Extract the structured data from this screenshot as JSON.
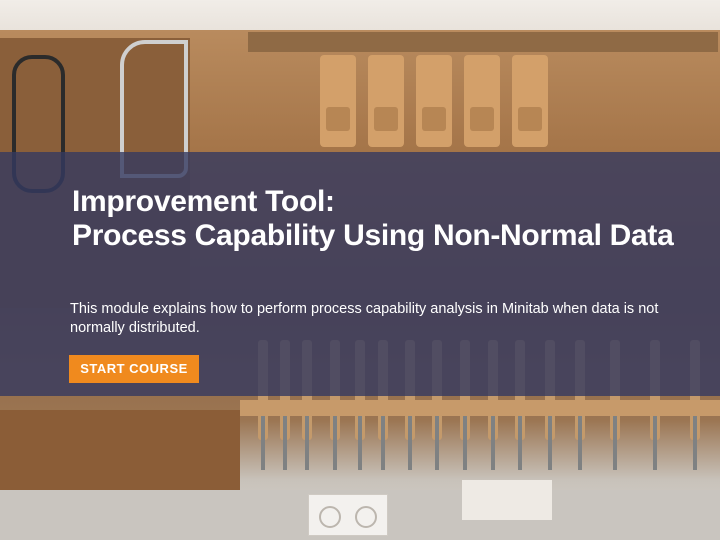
{
  "hero": {
    "title_line1": "Improvement Tool:",
    "title_line2": "Process Capability Using Non-Normal Data",
    "description": "This module explains how to perform process capability analysis in Minitab when data is not normally distributed.",
    "cta_label": "START COURSE"
  },
  "colors": {
    "overlay": "#343a60",
    "cta": "#f08a1e",
    "text": "#ffffff"
  },
  "background": {
    "subject": "workshop-tool-wall-photo"
  }
}
